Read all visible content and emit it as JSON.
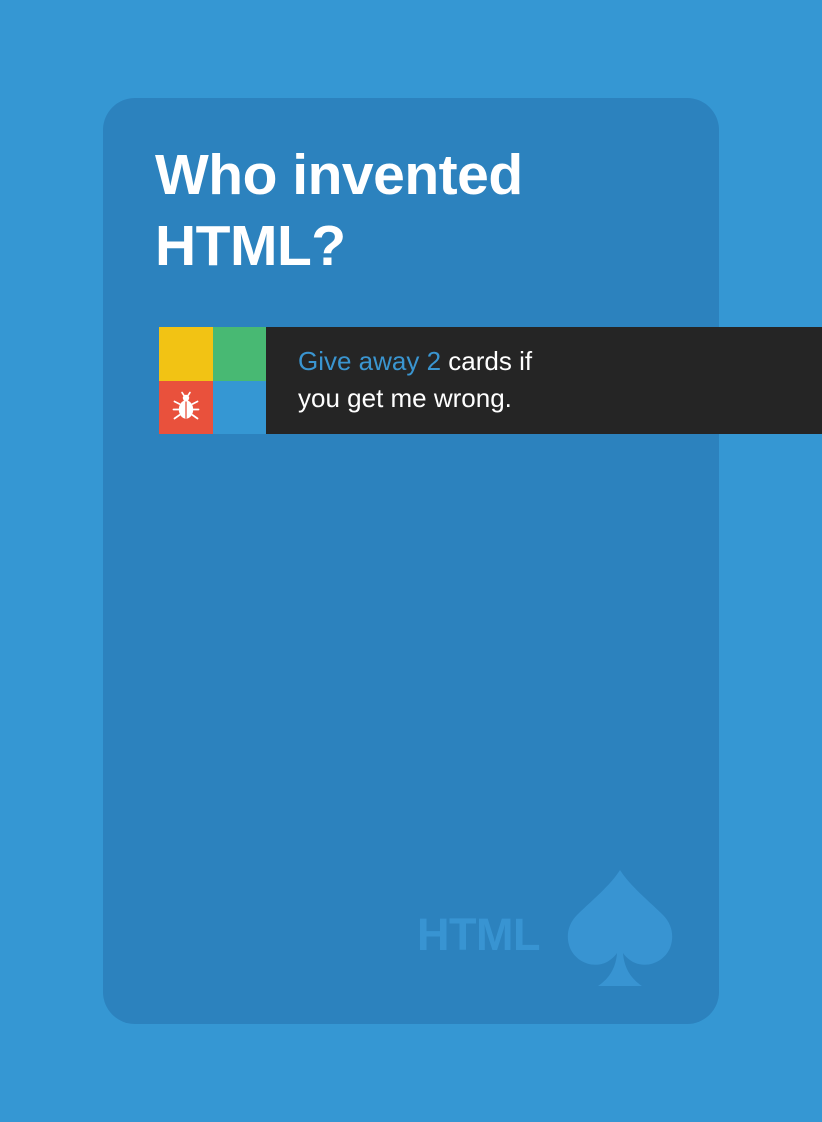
{
  "colors": {
    "page_background": "#3597d3",
    "card_background": "#2c82be",
    "rule_box": "#252525",
    "accent_text": "#3a95d0",
    "tile_yellow": "#f2c314",
    "tile_green": "#48b973",
    "tile_red": "#e9513c",
    "tile_blue": "#3597d3",
    "suit": "#3894d2",
    "white": "#ffffff"
  },
  "card": {
    "question_lines": [
      "Who invented",
      "HTML?"
    ],
    "rule": {
      "accent": "Give away 2",
      "line1_rest": " cards if",
      "line2": "you get me wrong."
    },
    "suit_label": "HTML",
    "suit_icon": "spade-icon",
    "tile_icon": "bug-icon"
  }
}
